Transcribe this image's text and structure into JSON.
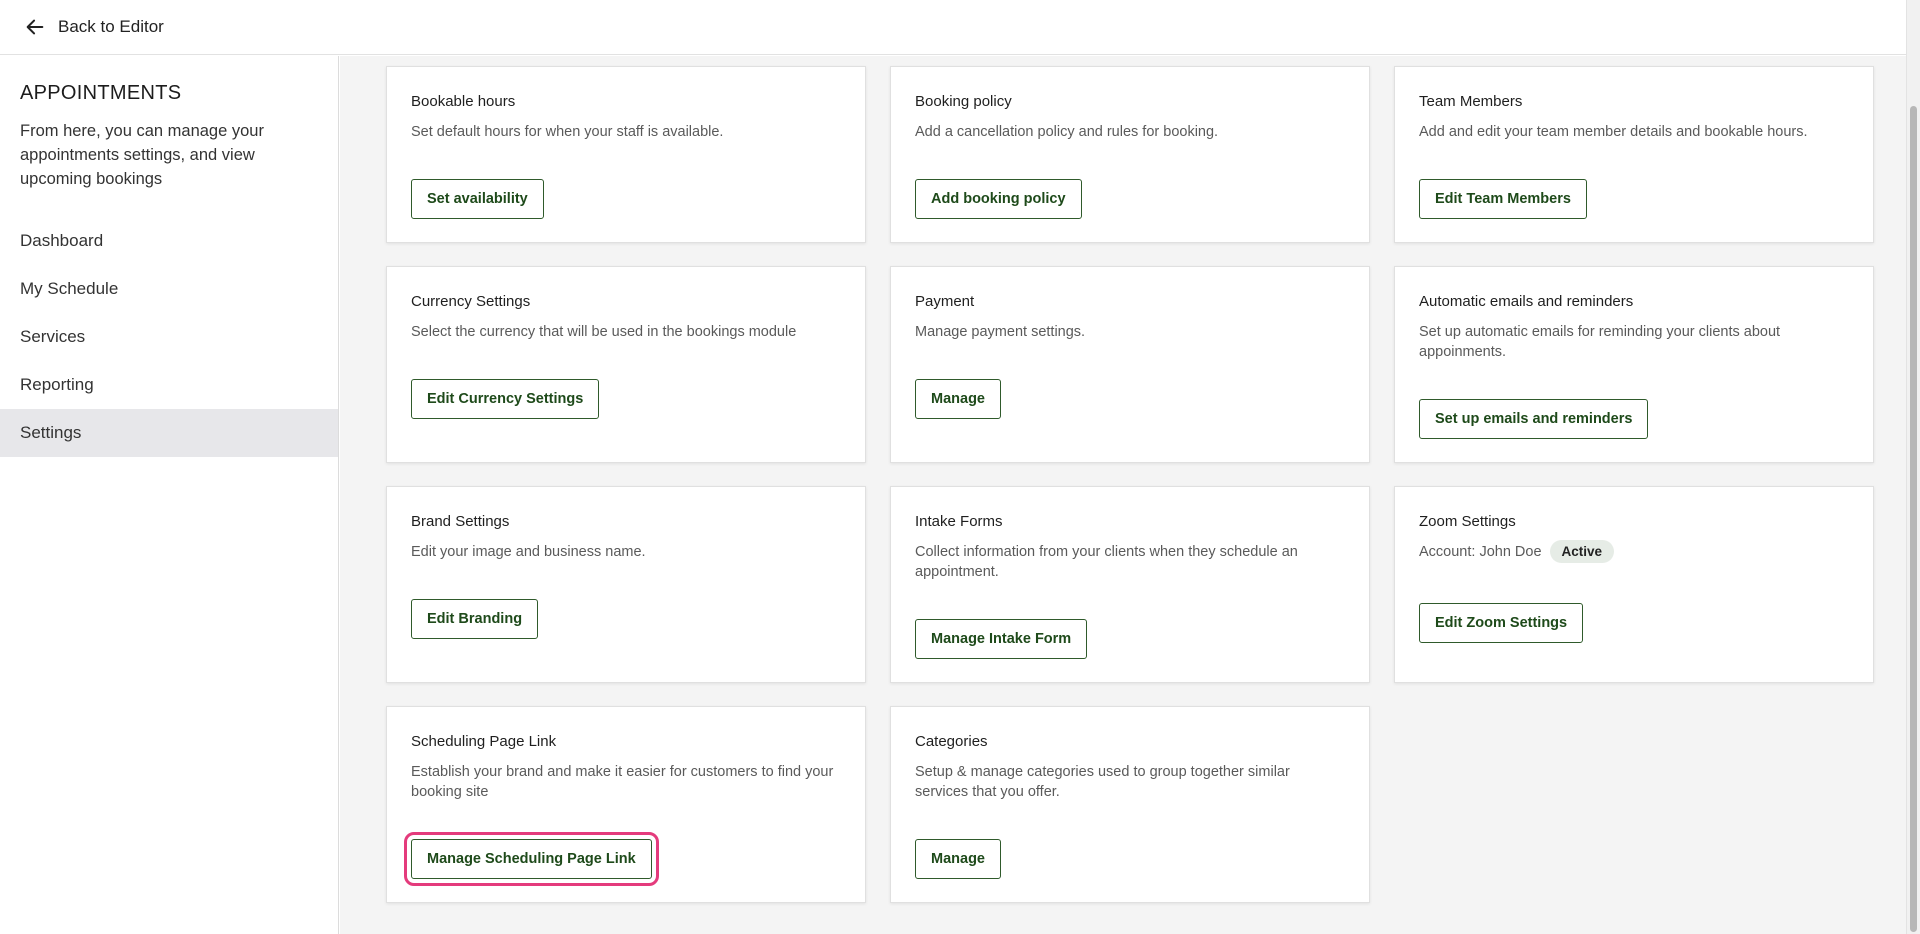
{
  "topbar": {
    "back_label": "Back to Editor"
  },
  "sidebar": {
    "title": "APPOINTMENTS",
    "description": "From here, you can manage your appointments settings, and view upcoming bookings",
    "items": [
      {
        "label": "Dashboard",
        "active": false
      },
      {
        "label": "My Schedule",
        "active": false
      },
      {
        "label": "Services",
        "active": false
      },
      {
        "label": "Reporting",
        "active": false
      },
      {
        "label": "Settings",
        "active": true
      }
    ]
  },
  "cards": [
    {
      "title": "Bookable hours",
      "description": "Set default hours for when your staff is available.",
      "button": "Set availability"
    },
    {
      "title": "Booking policy",
      "description": "Add a cancellation policy and rules for booking.",
      "button": "Add booking policy"
    },
    {
      "title": "Team Members",
      "description": "Add and edit your team member details and bookable hours.",
      "button": "Edit Team Members"
    },
    {
      "title": "Currency Settings",
      "description": "Select the currency that will be used in the bookings module",
      "button": "Edit Currency Settings"
    },
    {
      "title": "Payment",
      "description": "Manage payment settings.",
      "button": "Manage"
    },
    {
      "title": "Automatic emails and reminders",
      "description": "Set up automatic emails for reminding your clients about appoinments.",
      "button": "Set up emails and reminders"
    },
    {
      "title": "Brand Settings",
      "description": "Edit your image and business name.",
      "button": "Edit Branding"
    },
    {
      "title": "Intake Forms",
      "description": "Collect information from your clients when they schedule an appointment.",
      "button": "Manage Intake Form"
    },
    {
      "title": "Zoom Settings",
      "account": "Account: John Doe",
      "status": "Active",
      "button": "Edit Zoom Settings"
    },
    {
      "title": "Scheduling Page Link",
      "description": "Establish your brand and make it easier for customers to find your booking site",
      "button": "Manage Scheduling Page Link"
    },
    {
      "title": "Categories",
      "description": "Setup & manage categories used to group together similar services that you offer.",
      "button": "Manage"
    }
  ],
  "colors": {
    "button_border": "#2f5a2b",
    "highlight": "#e43b7c",
    "active_nav": "#e7e7ea"
  }
}
